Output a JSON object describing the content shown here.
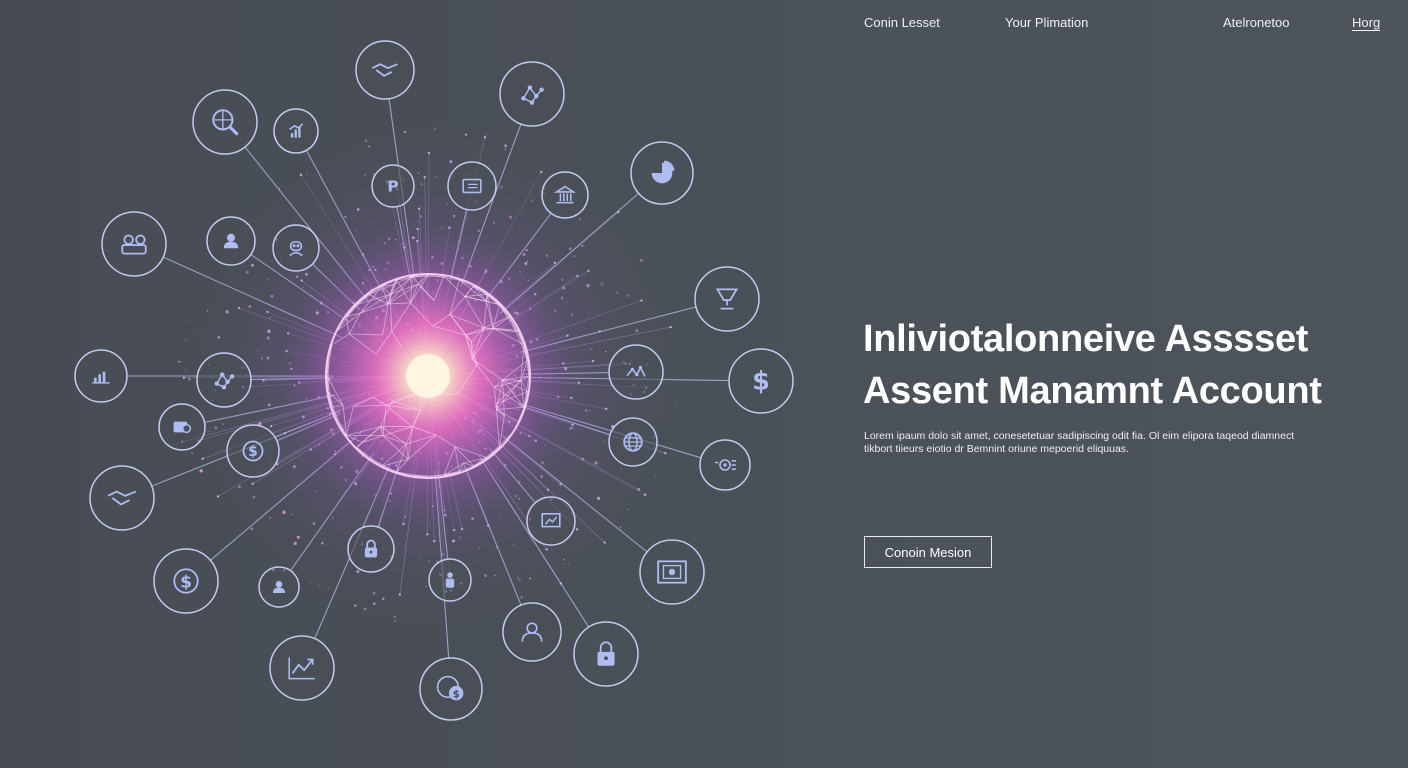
{
  "nav": {
    "items": [
      {
        "label": "Conin Lesset"
      },
      {
        "label": "Your Plimation"
      },
      {
        "label": "Atelronetoo"
      },
      {
        "label": "Horg"
      }
    ]
  },
  "hero": {
    "title_line1": "Inliviotalonneive Asssset",
    "title_line2": "Assent Manamnt Account",
    "description": "Lorem ipaum dolo sit amet, conesetetuar sadipiscing odit fia. Ol eim elipora taqeod diamnect tikbort tiieurs eiotio dr Bemnint oriune mepoerid eliquuas.",
    "cta_label": "Conoin Mesion"
  },
  "colors": {
    "background": "#4a5058",
    "icon_stroke": "#aebcf2",
    "glow_core": "#fff4e0",
    "glow_mid": "#ff6fd0",
    "glow_outer": "#b05ad8"
  },
  "network": {
    "icons": [
      "handshake-icon",
      "nodes-icon",
      "search-globe-icon",
      "bar-chart-icon",
      "parking-icon",
      "folder-icon",
      "bank-icon",
      "pie-chart-icon",
      "people-icon",
      "user-icon",
      "robot-icon",
      "trophy-icon",
      "line-chart-icon",
      "nodes-icon",
      "stock-chart-icon",
      "dollar-icon",
      "camera-icon",
      "dollar-coin-icon",
      "globe-icon",
      "target-icon",
      "handshake-icon",
      "monitor-chart-icon",
      "dollar-coin-icon",
      "user-icon",
      "lock-icon",
      "person-icon",
      "safe-icon",
      "growth-chart-icon",
      "user-circle-icon",
      "lock-icon",
      "coin-chat-icon"
    ]
  }
}
